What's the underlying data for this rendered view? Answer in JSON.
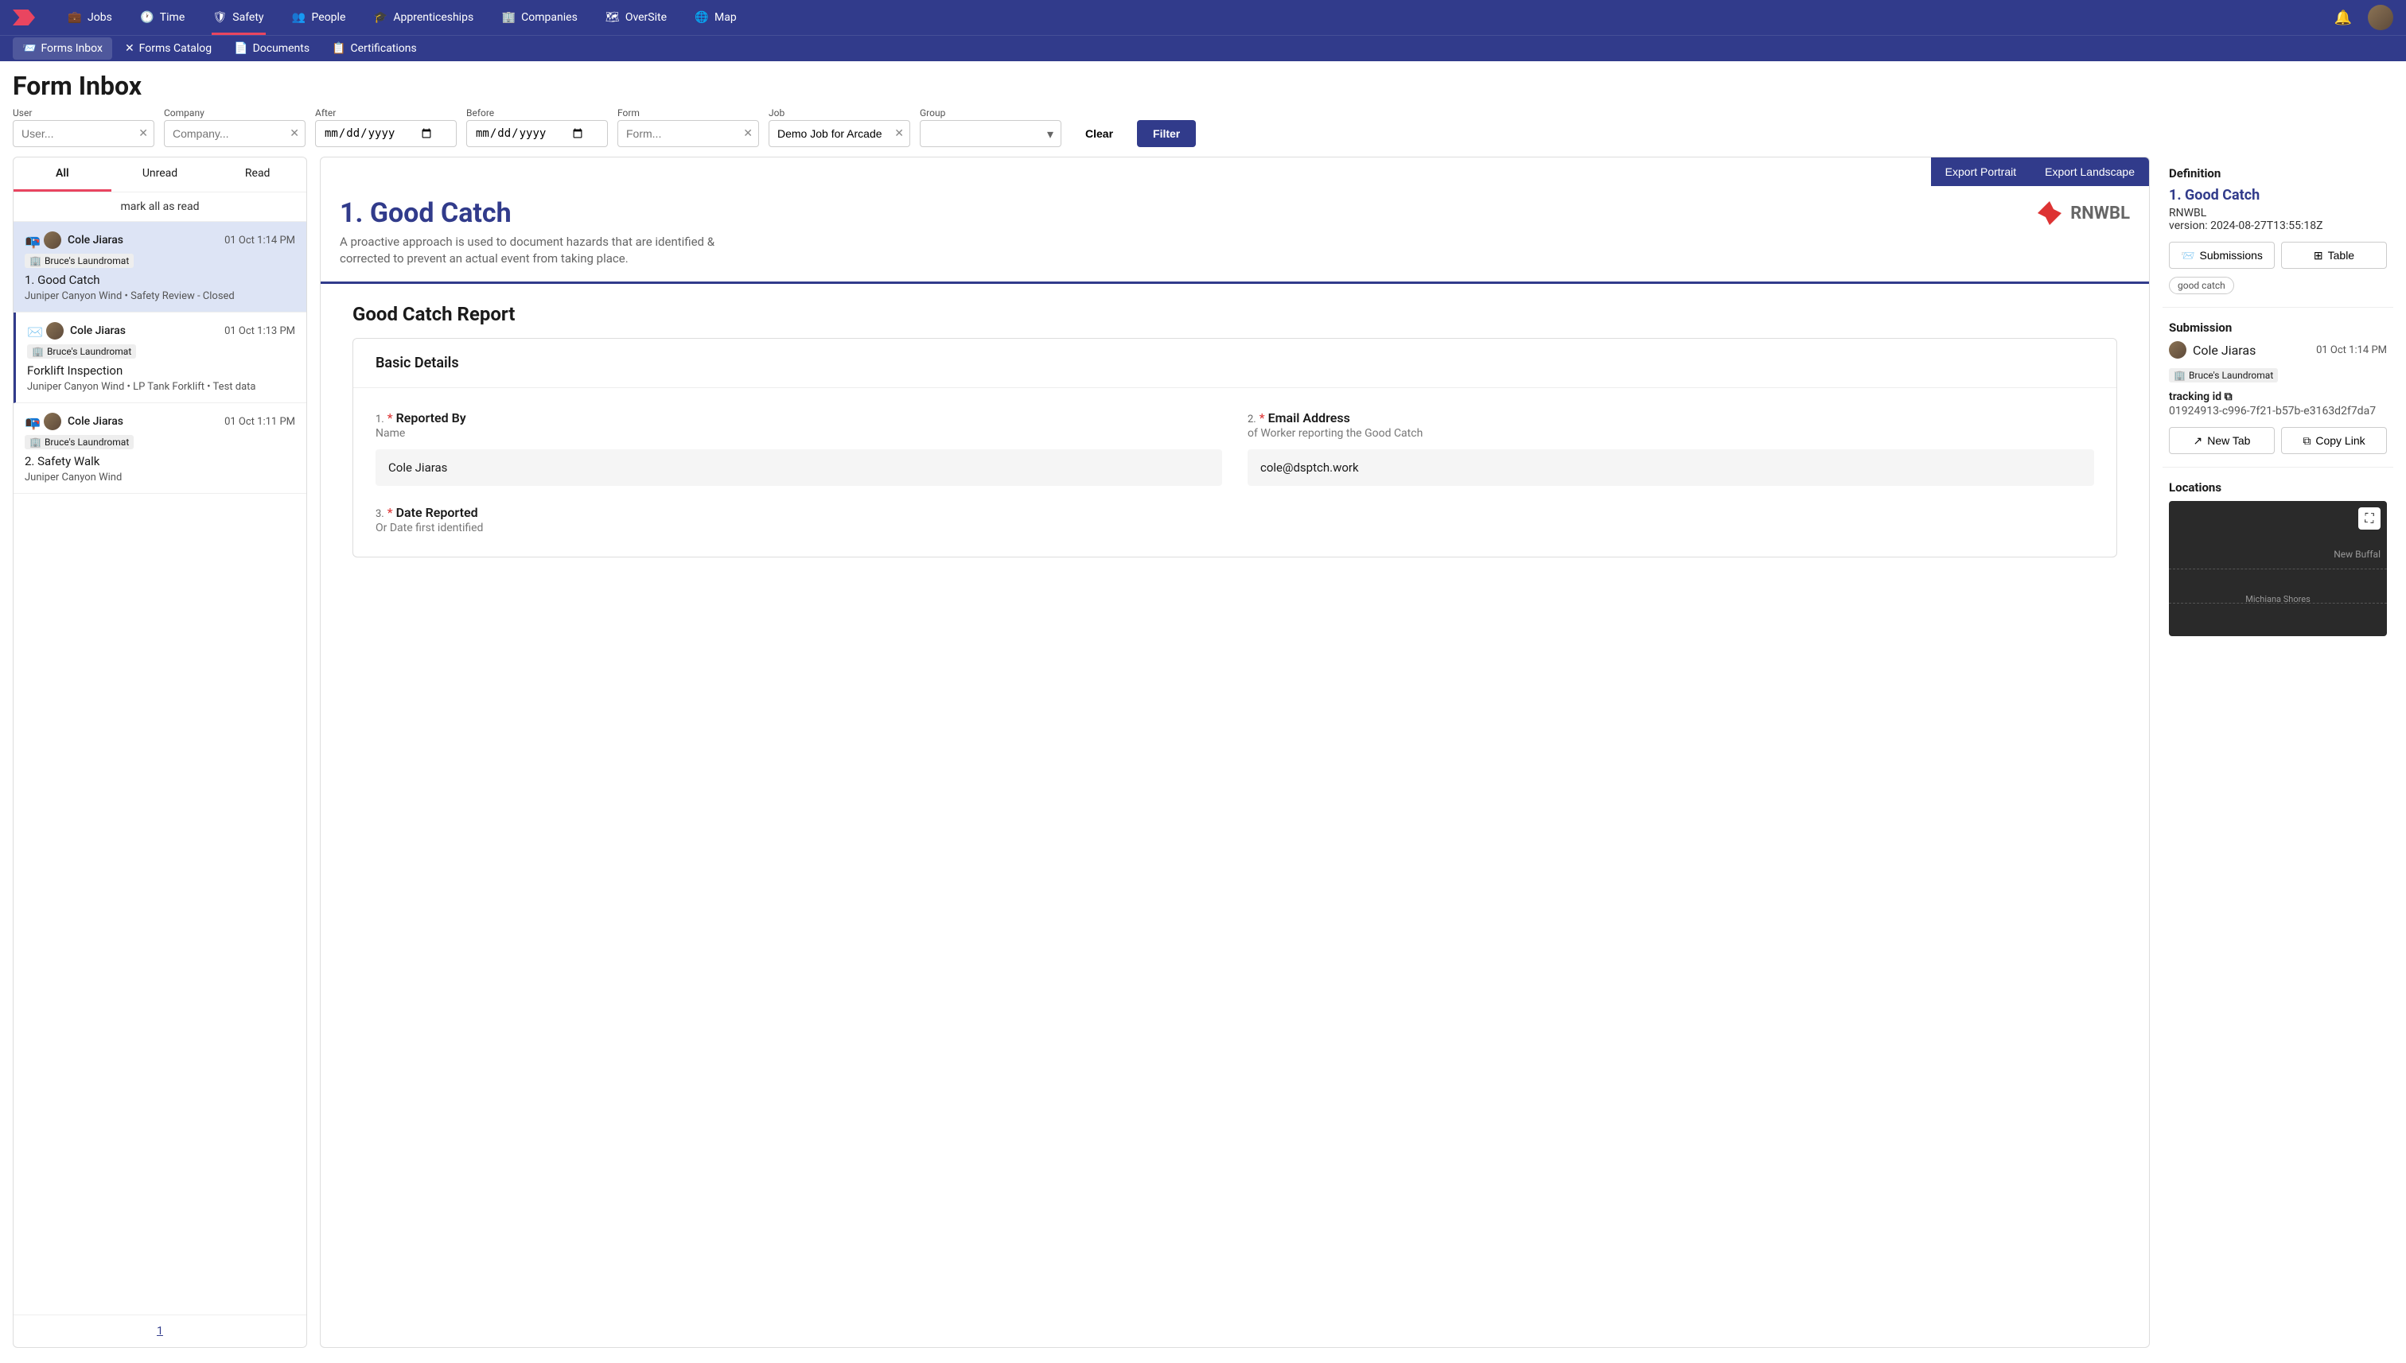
{
  "topNav": {
    "items": [
      {
        "label": "Jobs",
        "icon": "briefcase"
      },
      {
        "label": "Time",
        "icon": "clock"
      },
      {
        "label": "Safety",
        "icon": "shield",
        "active": true
      },
      {
        "label": "People",
        "icon": "users"
      },
      {
        "label": "Apprenticeships",
        "icon": "grad"
      },
      {
        "label": "Companies",
        "icon": "building"
      },
      {
        "label": "OverSite",
        "icon": "map-pin"
      },
      {
        "label": "Map",
        "icon": "globe"
      }
    ]
  },
  "subNav": {
    "items": [
      {
        "label": "Forms Inbox",
        "active": true
      },
      {
        "label": "Forms Catalog"
      },
      {
        "label": "Documents"
      },
      {
        "label": "Certifications"
      }
    ]
  },
  "pageTitle": "Form Inbox",
  "filters": {
    "user": {
      "label": "User",
      "placeholder": "User..."
    },
    "company": {
      "label": "Company",
      "placeholder": "Company..."
    },
    "after": {
      "label": "After",
      "placeholder": "mm/dd/yyyy"
    },
    "before": {
      "label": "Before",
      "placeholder": "mm/dd/yyyy"
    },
    "form": {
      "label": "Form",
      "placeholder": "Form..."
    },
    "job": {
      "label": "Job",
      "value": "Demo Job for Arcade"
    },
    "group": {
      "label": "Group"
    },
    "clearBtn": "Clear",
    "filterBtn": "Filter"
  },
  "inbox": {
    "tabs": {
      "all": "All",
      "unread": "Unread",
      "read": "Read"
    },
    "markAll": "mark all as read",
    "items": [
      {
        "sender": "Cole Jiaras",
        "time": "01 Oct 1:14 PM",
        "company": "Bruce's Laundromat",
        "title": "1. Good Catch",
        "meta": "Juniper Canyon Wind • Safety Review - Closed",
        "readIcon": "open",
        "selected": true
      },
      {
        "sender": "Cole Jiaras",
        "time": "01 Oct 1:13 PM",
        "company": "Bruce's Laundromat",
        "title": "Forklift Inspection",
        "meta": "Juniper Canyon Wind • LP Tank Forklift • Test data",
        "readIcon": "closed",
        "unread": true
      },
      {
        "sender": "Cole Jiaras",
        "time": "01 Oct 1:11 PM",
        "company": "Bruce's Laundromat",
        "title": "2. Safety Walk",
        "meta": "Juniper Canyon Wind",
        "readIcon": "open"
      }
    ],
    "page": "1"
  },
  "form": {
    "exportPortrait": "Export Portrait",
    "exportLandscape": "Export Landscape",
    "title": "1. Good Catch",
    "subtitle": "A proactive approach is used to document hazards that are identified & corrected to prevent an actual event from taking place.",
    "brand": "RNWBL",
    "sectionTitle": "Good Catch Report",
    "cardTitle": "Basic Details",
    "fields": [
      {
        "num": "1.",
        "label": "Reported By",
        "sublabel": "Name",
        "value": "Cole Jiaras"
      },
      {
        "num": "2.",
        "label": "Email Address",
        "sublabel": "of Worker reporting the Good Catch",
        "value": "cole@dsptch.work"
      },
      {
        "num": "3.",
        "label": "Date Reported",
        "sublabel": "Or Date first identified",
        "value": ""
      }
    ]
  },
  "details": {
    "definition": {
      "heading": "Definition",
      "link": "1. Good Catch",
      "org": "RNWBL",
      "version": "version: 2024-08-27T13:55:18Z",
      "submissionsBtn": "Submissions",
      "tableBtn": "Table",
      "tag": "good catch"
    },
    "submission": {
      "heading": "Submission",
      "sender": "Cole Jiaras",
      "time": "01 Oct 1:14 PM",
      "company": "Bruce's Laundromat",
      "trackingLabel": "tracking id",
      "trackingId": "01924913-c996-7f21-b57b-e3163d2f7da7",
      "newTabBtn": "New Tab",
      "copyLinkBtn": "Copy Link"
    },
    "locations": {
      "heading": "Locations",
      "label1": "New Buffal",
      "label2": "Michiana\nShores"
    }
  }
}
